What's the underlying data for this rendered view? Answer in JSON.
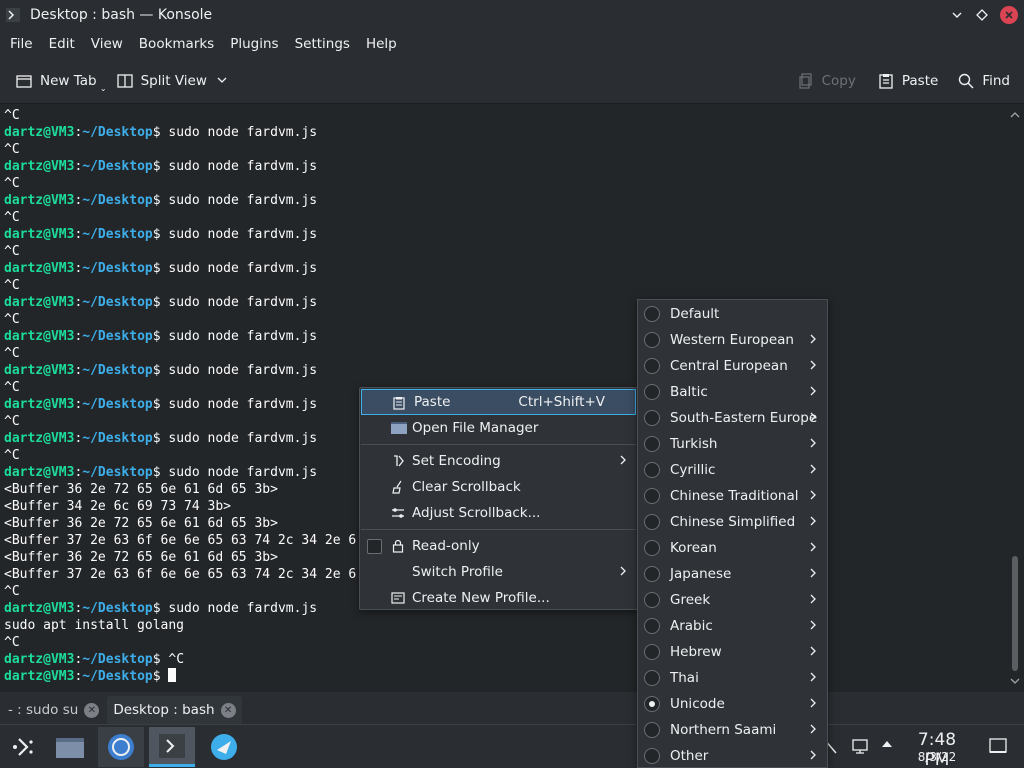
{
  "window": {
    "title": "Desktop : bash — Konsole"
  },
  "menubar": [
    "File",
    "Edit",
    "View",
    "Bookmarks",
    "Plugins",
    "Settings",
    "Help"
  ],
  "toolbar": {
    "new_tab": "New Tab",
    "split_view": "Split View",
    "copy": "Copy",
    "paste": "Paste",
    "find": "Find"
  },
  "terminal": {
    "prompt_user": "dartz@VM3",
    "prompt_path": "~/Desktop",
    "lines": [
      {
        "type": "out",
        "text": "^C"
      },
      {
        "type": "cmd",
        "text": " sudo node fardvm.js"
      },
      {
        "type": "out",
        "text": "^C"
      },
      {
        "type": "cmd",
        "text": " sudo node fardvm.js"
      },
      {
        "type": "out",
        "text": "^C"
      },
      {
        "type": "cmd",
        "text": " sudo node fardvm.js"
      },
      {
        "type": "out",
        "text": "^C"
      },
      {
        "type": "cmd",
        "text": " sudo node fardvm.js"
      },
      {
        "type": "out",
        "text": "^C"
      },
      {
        "type": "cmd",
        "text": " sudo node fardvm.js"
      },
      {
        "type": "out",
        "text": "^C"
      },
      {
        "type": "cmd",
        "text": " sudo node fardvm.js"
      },
      {
        "type": "out",
        "text": "^C"
      },
      {
        "type": "cmd",
        "text": " sudo node fardvm.js"
      },
      {
        "type": "out",
        "text": "^C"
      },
      {
        "type": "cmd",
        "text": " sudo node fardvm.js"
      },
      {
        "type": "out",
        "text": "^C"
      },
      {
        "type": "cmd",
        "text": " sudo node fardvm.js"
      },
      {
        "type": "out",
        "text": "^C"
      },
      {
        "type": "cmd",
        "text": " sudo node fardvm.js"
      },
      {
        "type": "out",
        "text": "^C"
      },
      {
        "type": "cmd",
        "text": " sudo node fardvm.js"
      },
      {
        "type": "out",
        "text": "<Buffer 36 2e 72 65 6e 61 6d 65 3b>"
      },
      {
        "type": "out",
        "text": "<Buffer 34 2e 6c 69 73 74 3b>"
      },
      {
        "type": "out",
        "text": "<Buffer 36 2e 72 65 6e 61 6d 65 3b>"
      },
      {
        "type": "out",
        "text": "<Buffer 37 2e 63 6f 6e 6e 65 63 74 2c 34 2e 6"
      },
      {
        "type": "out",
        "text": "<Buffer 36 2e 72 65 6e 61 6d 65 3b>"
      },
      {
        "type": "out",
        "text": "<Buffer 37 2e 63 6f 6e 6e 65 63 74 2c 34 2e 6"
      },
      {
        "type": "out",
        "text": "^C"
      },
      {
        "type": "cmd",
        "text": " sudo node fardvm.js"
      },
      {
        "type": "out",
        "text": "sudo apt install golang"
      },
      {
        "type": "out",
        "text": "^C"
      },
      {
        "type": "cmd",
        "text": " ^C"
      },
      {
        "type": "cursor",
        "text": " "
      }
    ]
  },
  "tabs": [
    {
      "label": "- : sudo su",
      "active": false
    },
    {
      "label": "Desktop : bash",
      "active": true
    }
  ],
  "context_menu": {
    "items": [
      {
        "label": "Paste",
        "shortcut": "Ctrl+Shift+V",
        "icon": "paste-icon",
        "highlighted": true
      },
      {
        "label": "Open File Manager",
        "icon": "folder-icon"
      },
      {
        "separator": true
      },
      {
        "label": "Set Encoding",
        "icon": "encoding-icon",
        "submenu": true
      },
      {
        "label": "Clear Scrollback",
        "icon": "broom-icon"
      },
      {
        "label": "Adjust Scrollback...",
        "icon": "sliders-icon"
      },
      {
        "separator": true
      },
      {
        "label": "Read-only",
        "icon": "lock-icon",
        "checkbox": true,
        "checked": false
      },
      {
        "label": "Switch Profile",
        "submenu": true
      },
      {
        "label": "Create New Profile...",
        "icon": "profile-icon"
      }
    ]
  },
  "encoding_menu": {
    "items": [
      {
        "label": "Default",
        "selected": false,
        "submenu": false
      },
      {
        "label": "Western European",
        "selected": false,
        "submenu": true
      },
      {
        "label": "Central European",
        "selected": false,
        "submenu": true
      },
      {
        "label": "Baltic",
        "selected": false,
        "submenu": true
      },
      {
        "label": "South-Eastern Europe",
        "selected": false,
        "submenu": true
      },
      {
        "label": "Turkish",
        "selected": false,
        "submenu": true
      },
      {
        "label": "Cyrillic",
        "selected": false,
        "submenu": true
      },
      {
        "label": "Chinese Traditional",
        "selected": false,
        "submenu": true
      },
      {
        "label": "Chinese Simplified",
        "selected": false,
        "submenu": true
      },
      {
        "label": "Korean",
        "selected": false,
        "submenu": true
      },
      {
        "label": "Japanese",
        "selected": false,
        "submenu": true
      },
      {
        "label": "Greek",
        "selected": false,
        "submenu": true
      },
      {
        "label": "Arabic",
        "selected": false,
        "submenu": true
      },
      {
        "label": "Hebrew",
        "selected": false,
        "submenu": true
      },
      {
        "label": "Thai",
        "selected": false,
        "submenu": true
      },
      {
        "label": "Unicode",
        "selected": true,
        "submenu": true
      },
      {
        "label": "Northern Saami",
        "selected": false,
        "submenu": true
      },
      {
        "label": "Other",
        "selected": false,
        "submenu": true
      }
    ]
  },
  "taskbar": {
    "clock_time": "7:48 PM",
    "clock_date": "8/3/22"
  },
  "colors": {
    "prompt_user": "#1cdc9a",
    "prompt_path": "#3daee9",
    "accent": "#3daee9",
    "close_button": "#da4453"
  }
}
